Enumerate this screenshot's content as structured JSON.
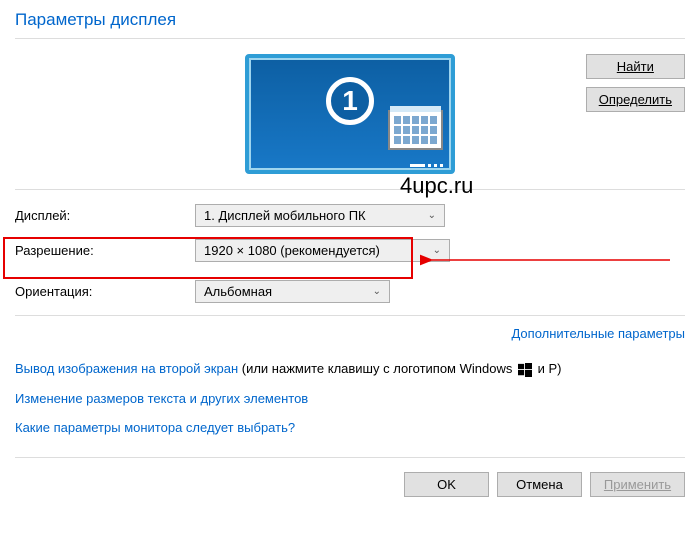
{
  "title": "Параметры дисплея",
  "monitor": {
    "number": "1"
  },
  "buttons": {
    "find": "Найти",
    "detect": "Определить",
    "ok": "OK",
    "cancel": "Отмена",
    "apply": "Применить"
  },
  "watermark": "4upc.ru",
  "labels": {
    "display": "Дисплей:",
    "resolution": "Разрешение:",
    "orientation": "Ориентация:"
  },
  "dropdowns": {
    "display": "1. Дисплей мобильного ПК",
    "resolution": "1920 × 1080 (рекомендуется)",
    "orientation": "Альбомная"
  },
  "links": {
    "advanced": "Дополнительные параметры",
    "second_screen": "Вывод изображения на второй экран",
    "second_screen_hint_pre": " (или нажмите клавишу с логотипом Windows ",
    "second_screen_hint_post": " и P)",
    "text_size": "Изменение размеров текста и других элементов",
    "which_settings": "Какие параметры монитора следует выбрать?"
  }
}
